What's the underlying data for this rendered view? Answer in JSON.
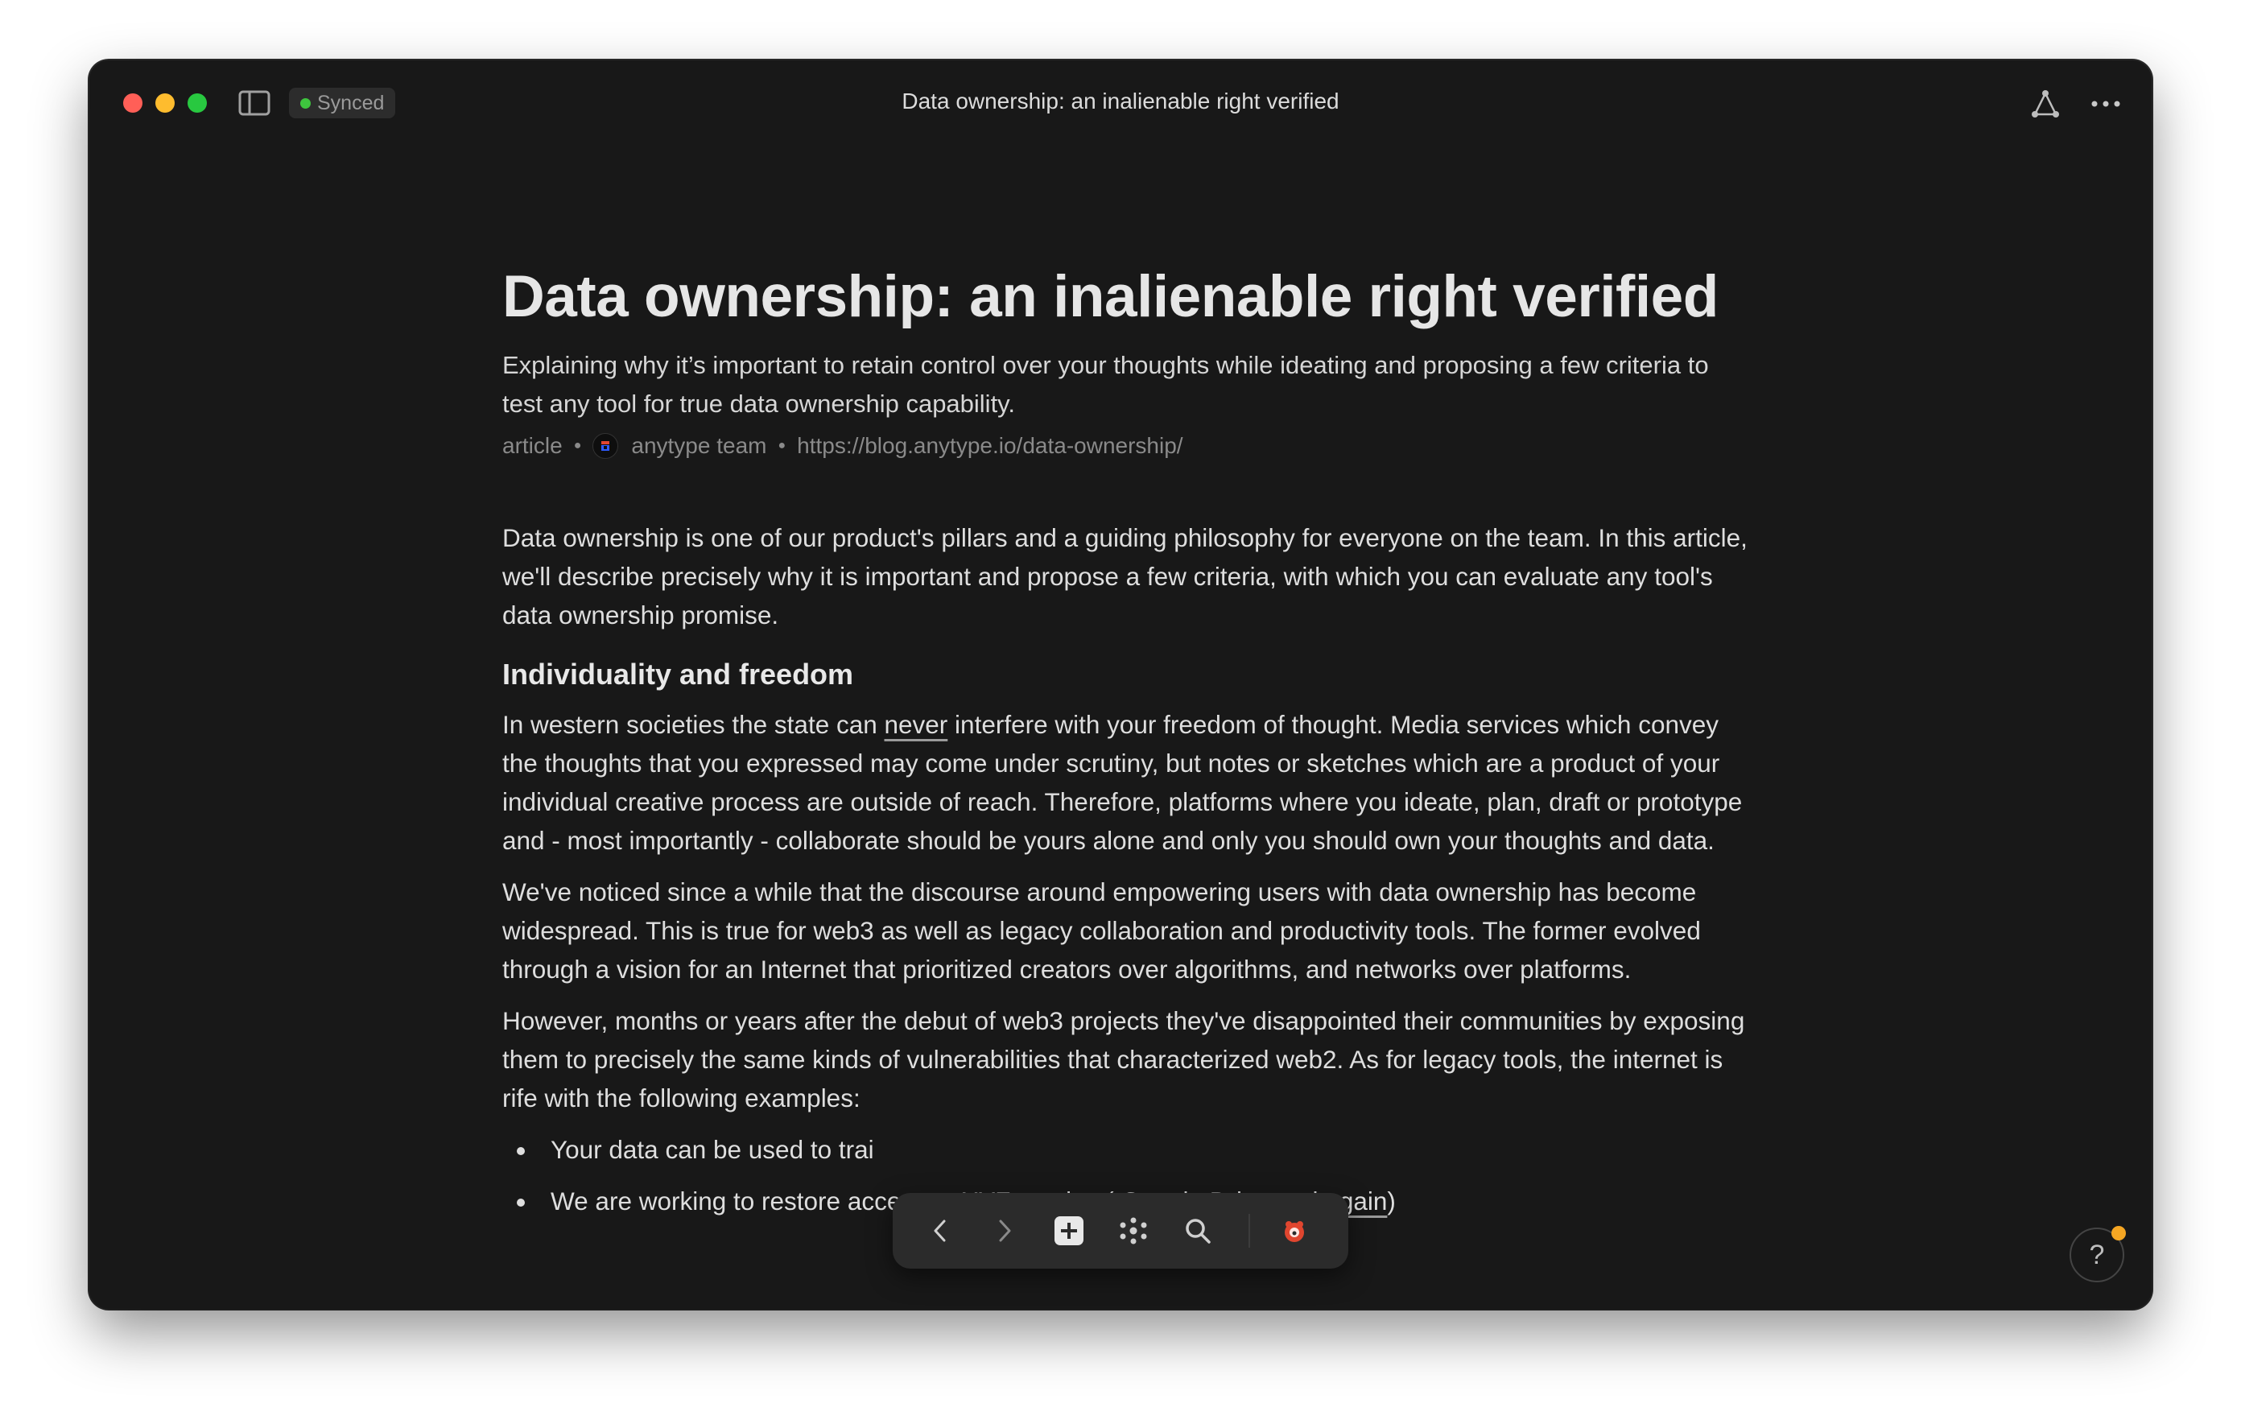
{
  "window": {
    "title": "Data ownership: an inalienable right verified",
    "sync_status": "Synced"
  },
  "document": {
    "title": "Data ownership: an inalienable right verified",
    "description": "Explaining why it’s important to retain control over your thoughts while ideating and proposing a few criteria to test any tool for true data ownership capability.",
    "meta": {
      "type": "article",
      "author": "anytype team",
      "url": "https://blog.anytype.io/data-ownership/"
    },
    "intro": "Data ownership is one of our product's pillars and a guiding philosophy for everyone on the team. In this article, we'll describe precisely why it is important and propose a few criteria, with which you can evaluate any tool's data ownership promise.",
    "section_heading": "Individuality and freedom",
    "p1_before": "In western societies the state can ",
    "p1_link": "never",
    "p1_after": " interfere with your freedom of thought. Media services which convey the thoughts that you expressed may come under scrutiny, but notes or sketches which are a product of your individual creative process are outside of reach. Therefore, platforms where you ideate, plan, draft or prototype and - most importantly - collaborate should be yours alone and only you should own your thoughts and data.",
    "p2": "We've noticed since a while that the discourse around empowering users with data ownership has become widespread. This is true for web3 as well as legacy collaboration and productivity tools. The former evolved through a vision for an Internet that prioritized creators over algorithms, and networks over platforms.",
    "p3": "However, months or years after the debut of web3 projects they've disappointed their communities by exposing them to precisely the same kinds of vulnerabilities that characterized web2. As for legacy tools, the internet is rife with the following examples:",
    "bullet1": "Your data can be used to trai",
    "bullet2_before": "We are working to restore access to XYZ service ( ",
    "bullet2_link1": "Google Drive",
    "bullet2_mid": " and ",
    "bullet2_link2": "again",
    "bullet2_after": ")"
  },
  "dock": {
    "items": [
      "back-icon",
      "forward-icon",
      "plus-icon",
      "graph-icon",
      "search-icon",
      "space-icon"
    ]
  },
  "help": {
    "label": "?"
  },
  "colors": {
    "background": "#181818",
    "sync_dot": "#3ec43e",
    "help_badge": "#f5a623"
  }
}
